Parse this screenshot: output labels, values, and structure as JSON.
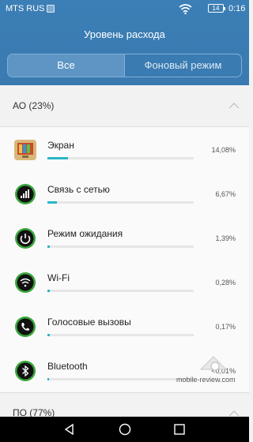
{
  "status_bar": {
    "carrier": "MTS RUS",
    "battery": "14",
    "time": "0:16"
  },
  "header": {
    "title": "Уровень расхода",
    "tabs": [
      {
        "label": "Все",
        "active": true
      },
      {
        "label": "Фоновый режим",
        "active": false
      }
    ]
  },
  "sections": [
    {
      "label": "АО (23%)",
      "expanded": true
    },
    {
      "label": "ПО (77%)",
      "expanded": false
    }
  ],
  "items": [
    {
      "label": "Экран",
      "percent": "14,08%",
      "fraction": 0.14,
      "icon": "screen-icon"
    },
    {
      "label": "Связь с сетью",
      "percent": "6,67%",
      "fraction": 0.067,
      "icon": "signal-icon"
    },
    {
      "label": "Режим ожидания",
      "percent": "1,39%",
      "fraction": 0.014,
      "icon": "power-icon"
    },
    {
      "label": "Wi-Fi",
      "percent": "0,28%",
      "fraction": 0.003,
      "icon": "wifi-icon"
    },
    {
      "label": "Голосовые вызовы",
      "percent": "0,17%",
      "fraction": 0.002,
      "icon": "phone-icon"
    },
    {
      "label": "Bluetooth",
      "percent": "<0,01%",
      "fraction": 0.0,
      "icon": "bluetooth-icon"
    }
  ],
  "watermark": "mobile-review.com",
  "colors": {
    "header": "#3b7fb6",
    "accent": "#29b6c8",
    "icon_green": "#3aa63a"
  }
}
